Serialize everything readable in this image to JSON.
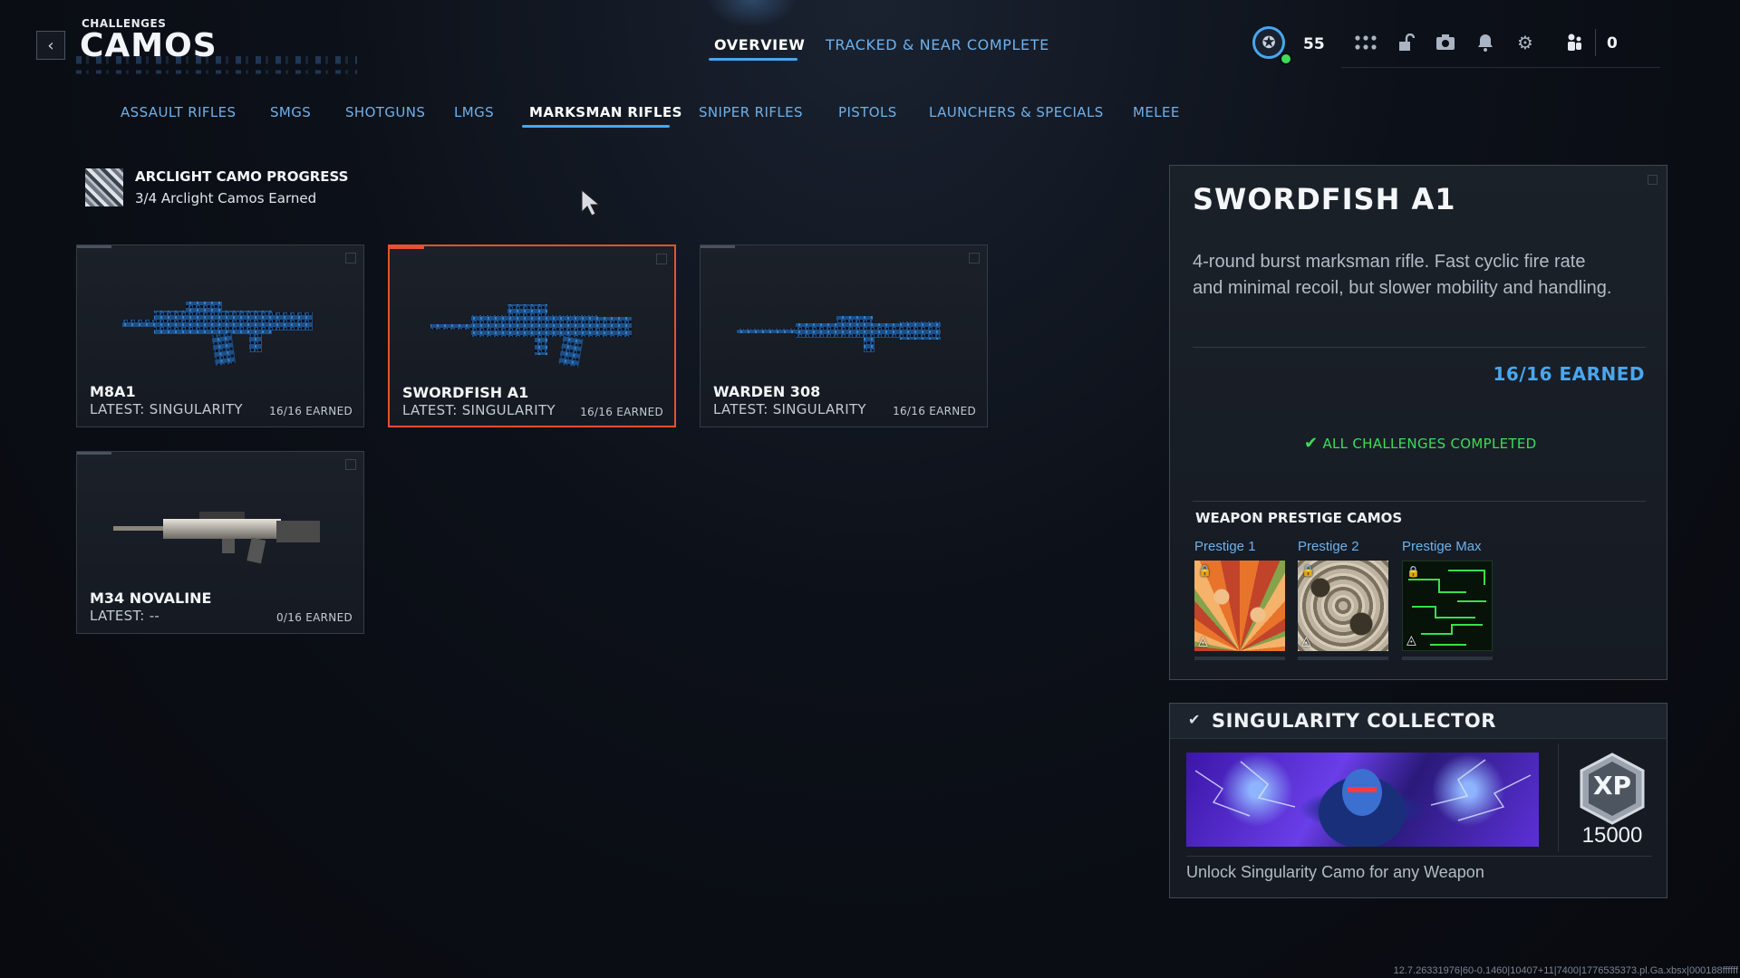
{
  "header": {
    "section": "CHALLENGES",
    "title": "CAMOS",
    "tabs": [
      {
        "label": "OVERVIEW",
        "active": true
      },
      {
        "label": "TRACKED & NEAR COMPLETE",
        "active": false
      }
    ],
    "rank_level": "55",
    "currency": "0",
    "icons": [
      "apps-grid-icon",
      "unlock-icon",
      "camera-icon",
      "bell-icon",
      "gear-icon",
      "party-icon"
    ]
  },
  "categories": [
    {
      "label": "ASSAULT RIFLES"
    },
    {
      "label": "SMGS"
    },
    {
      "label": "SHOTGUNS"
    },
    {
      "label": "LMGS"
    },
    {
      "label": "MARKSMAN RIFLES",
      "active": true
    },
    {
      "label": "SNIPER RIFLES"
    },
    {
      "label": "PISTOLS"
    },
    {
      "label": "LAUNCHERS & SPECIALS"
    },
    {
      "label": "MELEE"
    }
  ],
  "arclight": {
    "title": "ARCLIGHT CAMO PROGRESS",
    "subtitle": "3/4 Arclight Camos Earned"
  },
  "weapons": [
    {
      "name": "M8A1",
      "latest": "LATEST: SINGULARITY",
      "earned": "16/16 EARNED"
    },
    {
      "name": "SWORDFISH A1",
      "latest": "LATEST: SINGULARITY",
      "earned": "16/16 EARNED",
      "selected": true
    },
    {
      "name": "WARDEN 308",
      "latest": "LATEST: SINGULARITY",
      "earned": "16/16 EARNED"
    },
    {
      "name": "M34 NOVALINE",
      "latest": "LATEST: --",
      "earned": "0/16 EARNED"
    }
  ],
  "detail": {
    "title": "SWORDFISH A1",
    "description": "4-round burst marksman rifle. Fast cyclic fire rate and minimal recoil, but slower mobility and handling.",
    "earned": "16/16 EARNED",
    "completed": "ALL CHALLENGES COMPLETED",
    "prestige_heading": "WEAPON PRESTIGE CAMOS",
    "prestige": [
      {
        "label": "Prestige 1",
        "locked": true
      },
      {
        "label": "Prestige 2",
        "locked": true
      },
      {
        "label": "Prestige Max",
        "locked": true
      }
    ]
  },
  "collector": {
    "title": "SINGULARITY COLLECTOR",
    "xp_label": "XP",
    "xp_value": "15000",
    "description": "Unlock Singularity Camo for any Weapon"
  },
  "version_text": "12.7.26331976|60-0.1460|10407+11|7400|1776535373.pl.Ga.xbsx|000188ffffff",
  "colors": {
    "accent_blue": "#4aa6ee",
    "selected_border": "#e8512f",
    "success_green": "#3ddc5b"
  }
}
